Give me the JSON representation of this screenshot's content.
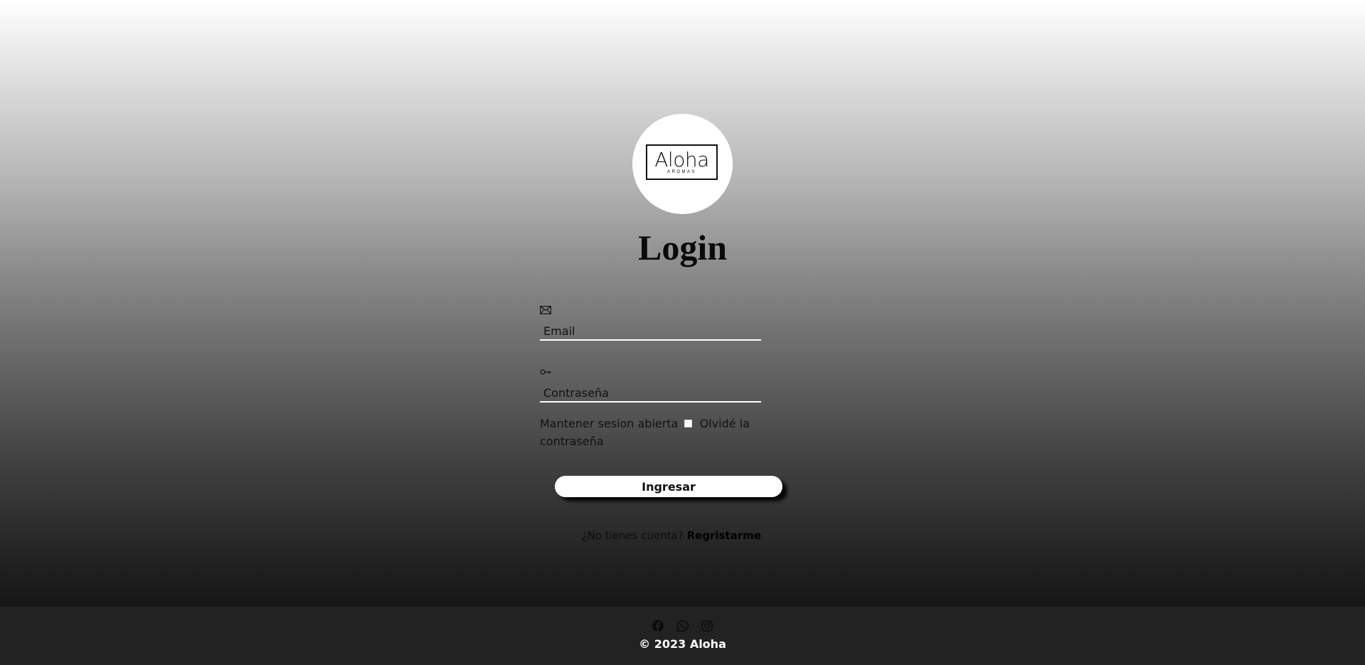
{
  "brand": {
    "logo_word": "Aloha",
    "logo_sub": "AROMAS"
  },
  "login": {
    "title": "Login",
    "email_icon": "envelope-icon",
    "email_placeholder": "Email",
    "password_icon": "key-icon",
    "password_placeholder": "Contraseña",
    "remember_label": "Mantener sesion abierta",
    "remember_checked": false,
    "forgot_label": "Olvidé la contraseña",
    "submit_label": "Ingresar",
    "no_account_text": "¿No tienes cuenta?",
    "register_label": "Regristarme"
  },
  "footer": {
    "social_icons": [
      "facebook-icon",
      "whatsapp-icon",
      "instagram-icon"
    ],
    "copyright": "© 2023 Aloha"
  },
  "colors": {
    "footer_bg": "#222222",
    "button_bg": "#ffffff",
    "input_underline": "#ffffff"
  }
}
